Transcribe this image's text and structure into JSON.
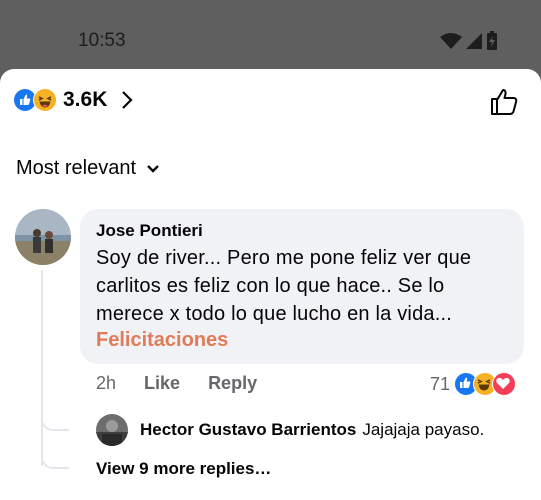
{
  "status_bar": {
    "time": "10:53",
    "icons": [
      "wifi-icon",
      "signal-icon",
      "battery-icon"
    ]
  },
  "reactions": {
    "count": "3.6K",
    "icons": [
      "like-icon",
      "haha-icon"
    ]
  },
  "sort": {
    "label": "Most relevant"
  },
  "comment": {
    "author": "Jose Pontieri",
    "text": "Soy de river... Pero me pone feliz ver que carlitos es feliz con lo que hace.. Se lo merece x todo lo que lucho en la vida...",
    "highlight": "Felicitaciones",
    "time": "2h",
    "like_label": "Like",
    "reply_label": "Reply",
    "reaction_count": "71",
    "reaction_icons": [
      "like-icon",
      "haha-icon",
      "love-icon"
    ]
  },
  "reply": {
    "author": "Hector Gustavo Barrientos",
    "text": "Jajajaja payaso."
  },
  "more_replies": "View 9 more replies…",
  "colors": {
    "like_blue": "#1877f2",
    "haha_yellow": "#f7b125",
    "love_red": "#f33e58",
    "link_orange": "#e07b57",
    "bubble_bg": "#f0f2f5",
    "secondary_text": "#65676b"
  }
}
